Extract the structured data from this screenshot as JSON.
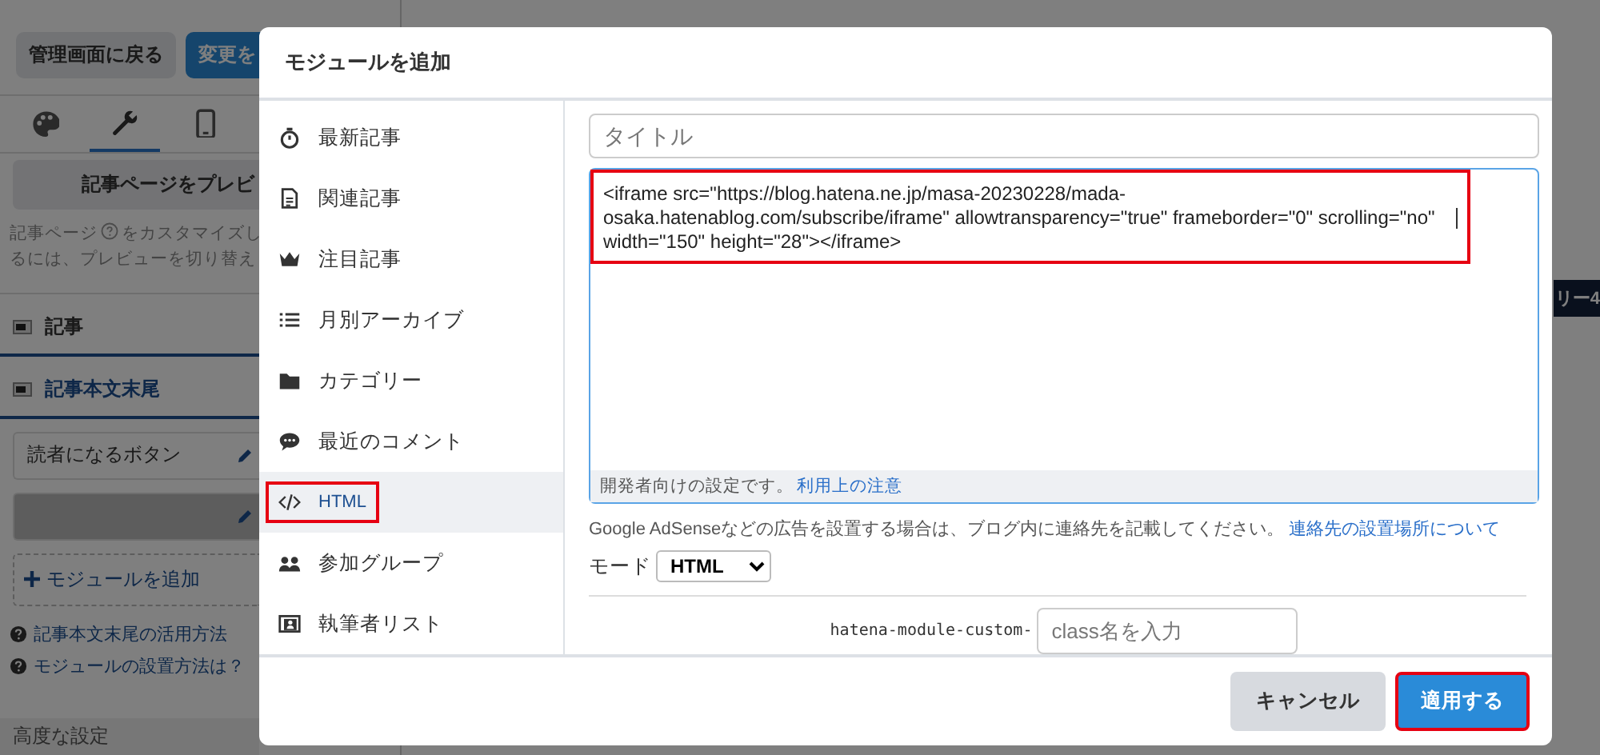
{
  "background_page": {
    "top_buttons": [
      {
        "label": "管理画面に戻る",
        "kind": "secondary"
      },
      {
        "label": "変更を",
        "kind": "primary"
      }
    ],
    "tabs": [
      {
        "kind": "palette",
        "selected": false
      },
      {
        "kind": "wrench",
        "selected": true
      },
      {
        "kind": "phone",
        "selected": false
      }
    ],
    "preview_button": "記事ページをプレビ",
    "description": {
      "before": "記事ページ",
      "after": "をカスタマイズし",
      "line2": "るには、プレビューを切り替え"
    },
    "sections": [
      {
        "label": "記事",
        "selected": false
      },
      {
        "label": "記事本文末尾",
        "selected": true
      }
    ],
    "modules": [
      {
        "label": "読者になるボタン",
        "kind": "normal"
      },
      {
        "kind": "dragging"
      }
    ],
    "add_module": "モジュールを追加",
    "help_links": [
      "記事本文末尾の活用方法",
      "モジュールの設置方法は？"
    ],
    "advanced": "高度な設定",
    "badge": "リー4"
  },
  "modal": {
    "title": "モジュールを追加",
    "module_types": [
      {
        "label": "最新記事",
        "kind": "stopwatch",
        "selected": false,
        "highlighted": false
      },
      {
        "label": "関連記事",
        "kind": "document",
        "selected": false,
        "highlighted": false
      },
      {
        "label": "注目記事",
        "kind": "crown",
        "selected": false,
        "highlighted": false
      },
      {
        "label": "月別アーカイブ",
        "kind": "list",
        "selected": false,
        "highlighted": false
      },
      {
        "label": "カテゴリー",
        "kind": "folder",
        "selected": false,
        "highlighted": false
      },
      {
        "label": "最近のコメント",
        "kind": "comment",
        "selected": false,
        "highlighted": false
      },
      {
        "label": "HTML",
        "kind": "code",
        "selected": true,
        "highlighted": true
      },
      {
        "label": "参加グループ",
        "kind": "group",
        "selected": false,
        "highlighted": false
      },
      {
        "label": "執筆者リスト",
        "kind": "author",
        "selected": false,
        "highlighted": false
      }
    ],
    "title_field": {
      "placeholder": "タイトル"
    },
    "html_field": {
      "value": "<iframe src=\"https://blog.hatena.ne.jp/masa-20230228/mada-osaka.hatenablog.com/subscribe/iframe\" allowtransparency=\"true\" frameborder=\"0\" scrolling=\"no\" width=\"150\" height=\"28\"></iframe>",
      "highlighted": true
    },
    "field_note": "開発者向けの設定です。",
    "field_note_link": "利用上の注意",
    "notice": "Google AdSenseなどの広告を設置する場合は、ブログ内に連絡先を記載してください。",
    "notice_link": "連絡先の設置場所について",
    "mode": {
      "label": "モード",
      "value": "HTML"
    },
    "class_prefix": "hatena-module-custom-",
    "class_field": {
      "placeholder": "class名を入力"
    },
    "buttons": [
      {
        "label": "キャンセル",
        "kind": "cancel",
        "highlighted": false
      },
      {
        "label": "適用する",
        "kind": "primary",
        "highlighted": true
      }
    ]
  }
}
